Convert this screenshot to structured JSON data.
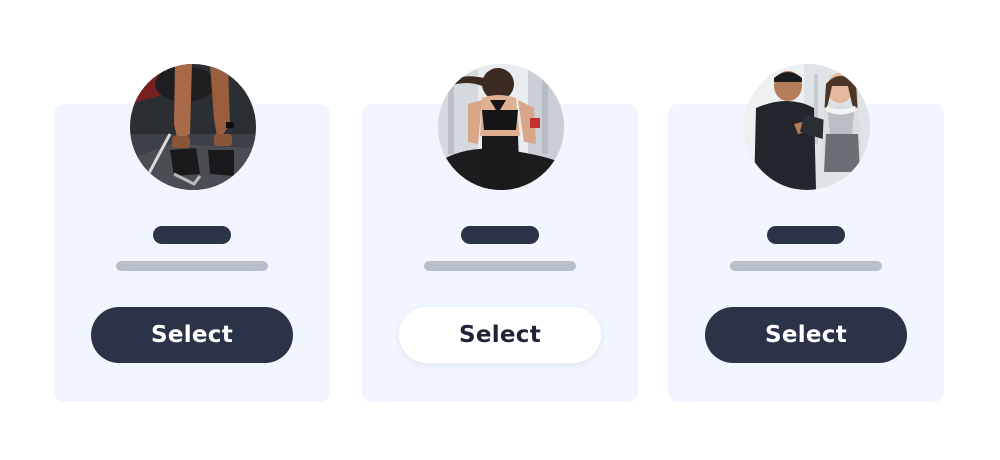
{
  "colors": {
    "card_background": "#f0f5fe",
    "name_placeholder": "#2a3348",
    "subtitle_placeholder": "#b8bfcb",
    "button_dark": "#2a3348",
    "button_light": "#ffffff"
  },
  "cards": [
    {
      "image": "workout-photo-icon",
      "button_label": "Select",
      "button_style": "dark"
    },
    {
      "image": "treadmill-runner-photo-icon",
      "button_label": "Select",
      "button_style": "light"
    },
    {
      "image": "trainer-client-photo-icon",
      "button_label": "Select",
      "button_style": "dark"
    }
  ]
}
